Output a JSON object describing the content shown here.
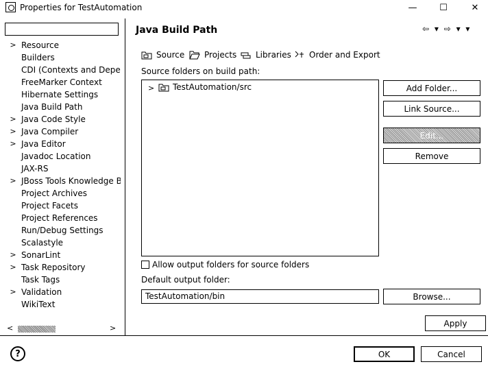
{
  "window": {
    "title": "Properties for TestAutomation",
    "minimize": "—",
    "maximize": "☐",
    "close": "✕"
  },
  "sidebar": {
    "filter_value": "",
    "items": [
      {
        "label": "Resource",
        "expandable": true
      },
      {
        "label": "Builders",
        "expandable": false
      },
      {
        "label": "CDI (Contexts and Depende",
        "expandable": false
      },
      {
        "label": "FreeMarker Context",
        "expandable": false
      },
      {
        "label": "Hibernate Settings",
        "expandable": false
      },
      {
        "label": "Java Build Path",
        "expandable": false
      },
      {
        "label": "Java Code Style",
        "expandable": true
      },
      {
        "label": "Java Compiler",
        "expandable": true
      },
      {
        "label": "Java Editor",
        "expandable": true
      },
      {
        "label": "Javadoc Location",
        "expandable": false
      },
      {
        "label": "JAX-RS",
        "expandable": false
      },
      {
        "label": "JBoss Tools Knowledge Bas",
        "expandable": true
      },
      {
        "label": "Project Archives",
        "expandable": false
      },
      {
        "label": "Project Facets",
        "expandable": false
      },
      {
        "label": "Project References",
        "expandable": false
      },
      {
        "label": "Run/Debug Settings",
        "expandable": false
      },
      {
        "label": "Scalastyle",
        "expandable": false
      },
      {
        "label": "SonarLint",
        "expandable": true
      },
      {
        "label": "Task Repository",
        "expandable": true
      },
      {
        "label": "Task Tags",
        "expandable": false
      },
      {
        "label": "Validation",
        "expandable": true
      },
      {
        "label": "WikiText",
        "expandable": false
      }
    ]
  },
  "main": {
    "title": "Java Build Path",
    "nav_arrows": "⇦ ▾ ⇨ ▾ ▾",
    "tabs": [
      {
        "label": "Source",
        "icon": "source-icon"
      },
      {
        "label": "Projects",
        "icon": "projects-icon"
      },
      {
        "label": "Libraries",
        "icon": "libraries-icon"
      },
      {
        "label": "Order and Export",
        "icon": "order-export-icon"
      }
    ],
    "source_folders_label": "Source folders on build path:",
    "source_entries": [
      {
        "label": "TestAutomation/src"
      }
    ],
    "buttons": {
      "add_folder": "Add Folder...",
      "link_source": "Link Source...",
      "edit": "Edit...",
      "remove": "Remove"
    },
    "allow_output_label": "Allow output folders for source folders",
    "default_output_label": "Default output folder:",
    "default_output_value": "TestAutomation/bin",
    "browse": "Browse...",
    "apply": "Apply"
  },
  "footer": {
    "help": "?",
    "ok": "OK",
    "cancel": "Cancel"
  }
}
